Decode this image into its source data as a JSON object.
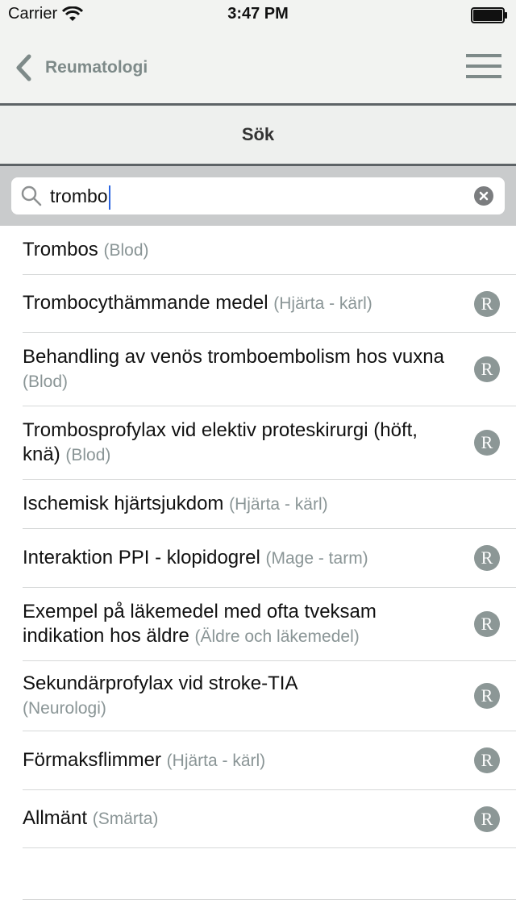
{
  "status_bar": {
    "carrier": "Carrier",
    "time": "3:47 PM"
  },
  "nav": {
    "back_label": "Reumatologi"
  },
  "section": {
    "title": "Sök"
  },
  "search": {
    "value": "trombo"
  },
  "results": [
    {
      "title": "Trombos",
      "category": "(Blod)",
      "badge": ""
    },
    {
      "title": "Trombocythämmande medel",
      "category": "(Hjärta - kärl)",
      "badge": "R"
    },
    {
      "title": "Behandling av venös tromboembolism hos vuxna",
      "category": "(Blod)",
      "badge": "R"
    },
    {
      "title": "Trombosprofylax vid elektiv proteskirurgi (höft, knä)",
      "category": "(Blod)",
      "badge": "R"
    },
    {
      "title": "Ischemisk hjärtsjukdom",
      "category": "(Hjärta - kärl)",
      "badge": ""
    },
    {
      "title": "Interaktion PPI - klopidogrel",
      "category": "(Mage - tarm)",
      "badge": "R"
    },
    {
      "title": "Exempel på läkemedel med ofta tveksam indikation hos äldre",
      "category": "(Äldre och läkemedel)",
      "badge": "R"
    },
    {
      "title": "Sekundärprofylax vid stroke-TIA",
      "category": "(Neurologi)",
      "badge": "R"
    },
    {
      "title": "Förmaksflimmer",
      "category": "(Hjärta - kärl)",
      "badge": "R"
    },
    {
      "title": "Allmänt",
      "category": "(Smärta)",
      "badge": "R"
    }
  ]
}
